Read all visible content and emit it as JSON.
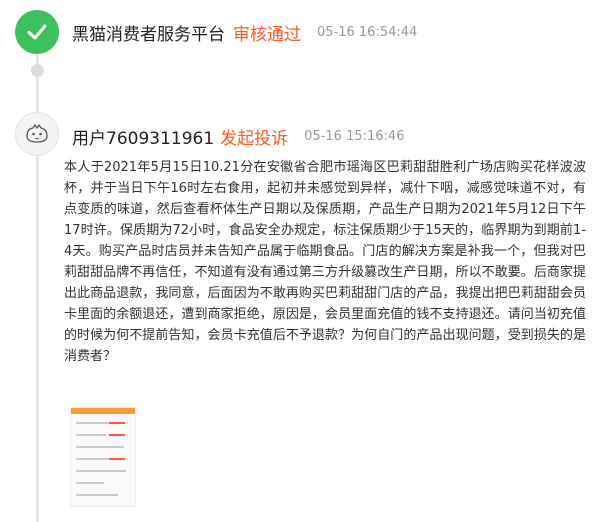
{
  "accent_color": "#ff5a1f",
  "approved_color": "#3dc05e",
  "step1": {
    "icon": "checkmark-icon",
    "platform": "黑猫消费者服务平台",
    "status": "审核通过",
    "time": "05-16 16:54:44"
  },
  "step2": {
    "avatar": "user-avatar",
    "user": "用户7609311961",
    "action": "发起投诉",
    "time": "05-16 15:16:46",
    "content": "本人于2021年5月15日10.21分在安徽省合肥市瑶海区巴莉甜甜胜利广场店购买花样波波杯，并于当日下午16时左右食用，起初并未感觉到异样，减什下咽，减感觉味道不对，有点变质的味道，然后查看杯体生产日期以及保质期，产品生产日期为2021年5月12日下午17时许。保质期为72小时，食品安全办规定，标注保质期少于15天的，临界期为到期前1-4天。购买产品时店员并未告知产品属于临期食品。门店的解决方案是补我一个，但我对巴莉甜甜品牌不再信任，不知道有没有通过第三方升级篡改生产日期，所以不敢要。后商家提出此商品退款，我同意，后面因为不敢再购买巴莉甜甜门店的产品，我提出把巴莉甜甜会员卡里面的余额退还，遭到商家拒绝，原因是，会员里面充值的钱不支持退还。请问当初充值的时候为何不提前告知，会员卡充值后不予退款？为何自门的产品出现问题，受到损失的是消费者？",
    "attachment_icon": "image-thumbnail"
  }
}
